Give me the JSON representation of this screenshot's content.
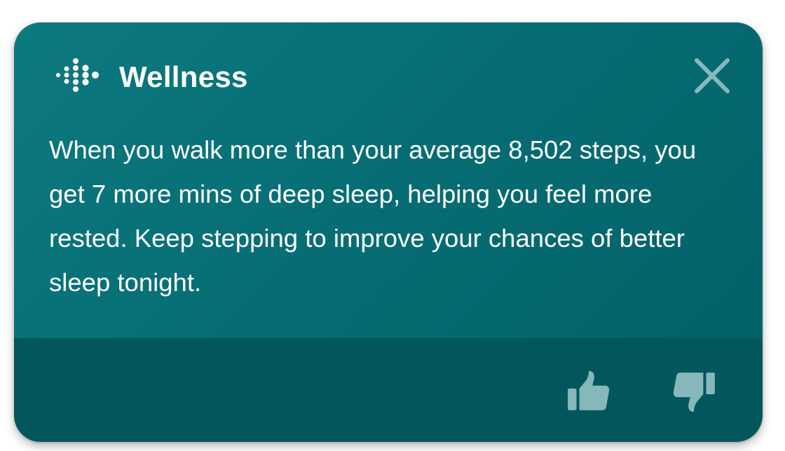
{
  "card": {
    "title": "Wellness",
    "logo_icon": "fitbit-logo-icon",
    "close_icon": "close-icon",
    "message": "When you walk more than your average 8,502 steps, you get 7 more mins of deep sleep, helping you feel more rested. Keep stepping to improve your chances of better sleep tonight.",
    "feedback": {
      "like_icon": "thumbs-up-icon",
      "dislike_icon": "thumbs-down-icon"
    }
  },
  "colors": {
    "card_background": "#066d74",
    "footer_background": "#02575d",
    "text": "#ffffff",
    "icon_muted": "#86b8bb"
  }
}
